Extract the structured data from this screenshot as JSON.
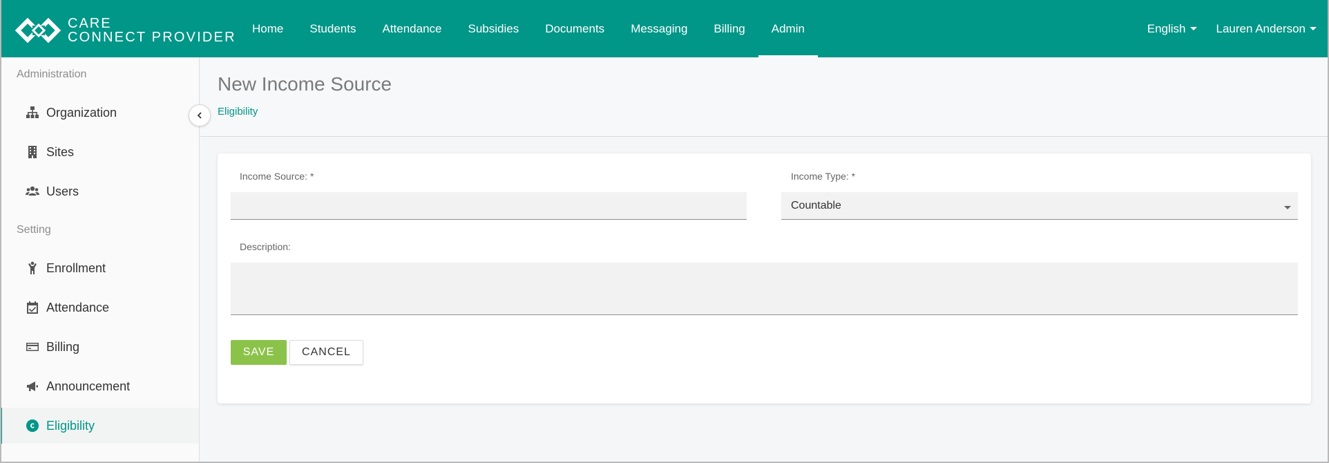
{
  "brand": {
    "line1": "CARE",
    "line2": "CONNECT PROVIDER",
    "icon": "care-connect-logo"
  },
  "nav": {
    "items": [
      {
        "label": "Home"
      },
      {
        "label": "Students"
      },
      {
        "label": "Attendance"
      },
      {
        "label": "Subsidies"
      },
      {
        "label": "Documents"
      },
      {
        "label": "Messaging"
      },
      {
        "label": "Billing"
      },
      {
        "label": "Admin",
        "active": true
      }
    ],
    "language": "English",
    "user": "Lauren Anderson"
  },
  "sidebar": {
    "sections": [
      {
        "label": "Administration"
      },
      {
        "label": "Setting"
      }
    ],
    "items": [
      {
        "label": "Organization",
        "icon": "sitemap-icon"
      },
      {
        "label": "Sites",
        "icon": "building-icon"
      },
      {
        "label": "Users",
        "icon": "users-icon"
      },
      {
        "label": "Enrollment",
        "icon": "child-icon"
      },
      {
        "label": "Attendance",
        "icon": "calendar-check-icon"
      },
      {
        "label": "Billing",
        "icon": "credit-card-icon"
      },
      {
        "label": "Announcement",
        "icon": "bullhorn-icon"
      },
      {
        "label": "Eligibility",
        "icon": "copyright-icon",
        "active": true
      }
    ]
  },
  "page": {
    "title": "New Income Source",
    "breadcrumb": "Eligibility"
  },
  "form": {
    "income_source": {
      "label": "Income Source: *",
      "value": ""
    },
    "income_type": {
      "label": "Income Type: *",
      "value": "Countable"
    },
    "description": {
      "label": "Description:",
      "value": ""
    },
    "save_label": "SAVE",
    "cancel_label": "CANCEL"
  },
  "colors": {
    "primary": "#009688",
    "save": "#8bc34a"
  }
}
